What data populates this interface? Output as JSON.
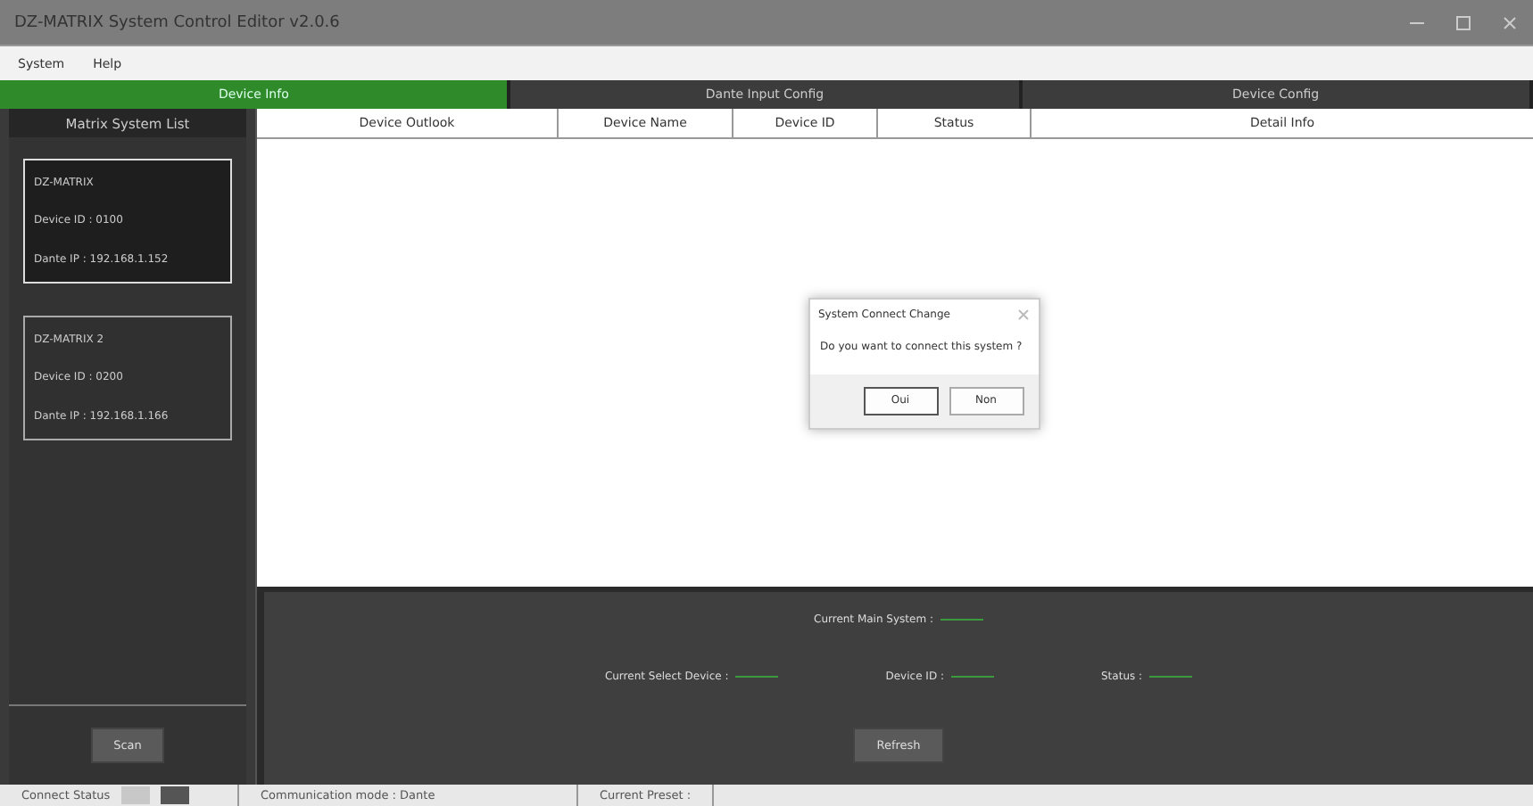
{
  "window": {
    "title": "DZ-MATRIX System Control Editor v2.0.6"
  },
  "menu": [
    "System",
    "Help"
  ],
  "tabs": [
    {
      "label": "Device Info",
      "selected": true
    },
    {
      "label": "Dante Input Config",
      "selected": false
    },
    {
      "label": "Device Config",
      "selected": false
    }
  ],
  "sidebar": {
    "title": "Matrix System List",
    "systems": [
      {
        "name": "DZ-MATRIX",
        "device_id": "Device ID : 0100",
        "dante_ip": "Dante IP : 192.168.1.152",
        "selected": true
      },
      {
        "name": "DZ-MATRIX 2",
        "device_id": "Device ID : 0200",
        "dante_ip": "Dante IP : 192.168.1.166",
        "selected": false
      }
    ],
    "scan_button": "Scan"
  },
  "table": {
    "columns": [
      "Device Outlook",
      "Device Name",
      "Device ID",
      "Status",
      "Detail Info"
    ]
  },
  "dialog": {
    "title": "System Connect Change",
    "message": "Do you want to connect this system ?",
    "buttons": [
      "Oui",
      "Non"
    ]
  },
  "info_panel": {
    "main_system": "Current Main System :",
    "select_device": "Current Select Device :",
    "device_id": "Device ID :",
    "status": "Status :",
    "refresh_button": "Refresh"
  },
  "status_bar": {
    "connect_status": "Connect Status",
    "communication_mode": "Communication mode : Dante",
    "current_preset": "Current Preset :"
  }
}
